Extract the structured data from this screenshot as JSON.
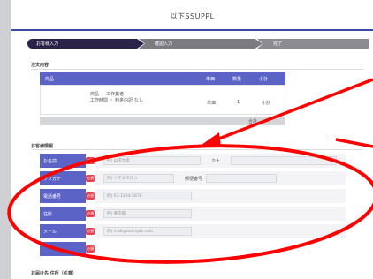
{
  "header": {
    "title": "以下SSUPPL"
  },
  "steps": [
    {
      "label": "お客様入力"
    },
    {
      "label": "確認入力"
    },
    {
      "label": "完了"
    }
  ],
  "order_section": {
    "label": "注文内容",
    "table_headers": [
      "商品",
      "単価",
      "数量",
      "小計"
    ],
    "item_line_1": "商品 ・ 工作業者",
    "item_line_2": "工作時間 ・ 料金内訳 なし",
    "price": "単価",
    "qty": "1",
    "subtotal": "小計",
    "total_label": "合計"
  },
  "form_section": {
    "label": "お客様情報",
    "required_badge": "必須",
    "rows": [
      {
        "label": "お名前",
        "placeholder": "例) 山田太郎",
        "sub_label": "カナ",
        "second_placeholder": ""
      },
      {
        "label": "フリガナ",
        "placeholder": "例) ヤマダタロウ",
        "sub_label": "郵便番号",
        "second_placeholder": ""
      },
      {
        "label": "電話番号",
        "placeholder": "例) 03-1234-5678"
      },
      {
        "label": "住所",
        "placeholder": "例) 東京都"
      },
      {
        "label": "メール",
        "placeholder": "例) mail@example.com"
      },
      {
        "label": ""
      }
    ]
  },
  "footer_section": {
    "label": "お届け先 住所（任意）"
  },
  "colors": {
    "accent": "#5b63c6",
    "required": "#e2404f",
    "annotation": "#ff0000",
    "step_active": "#2a2347"
  }
}
